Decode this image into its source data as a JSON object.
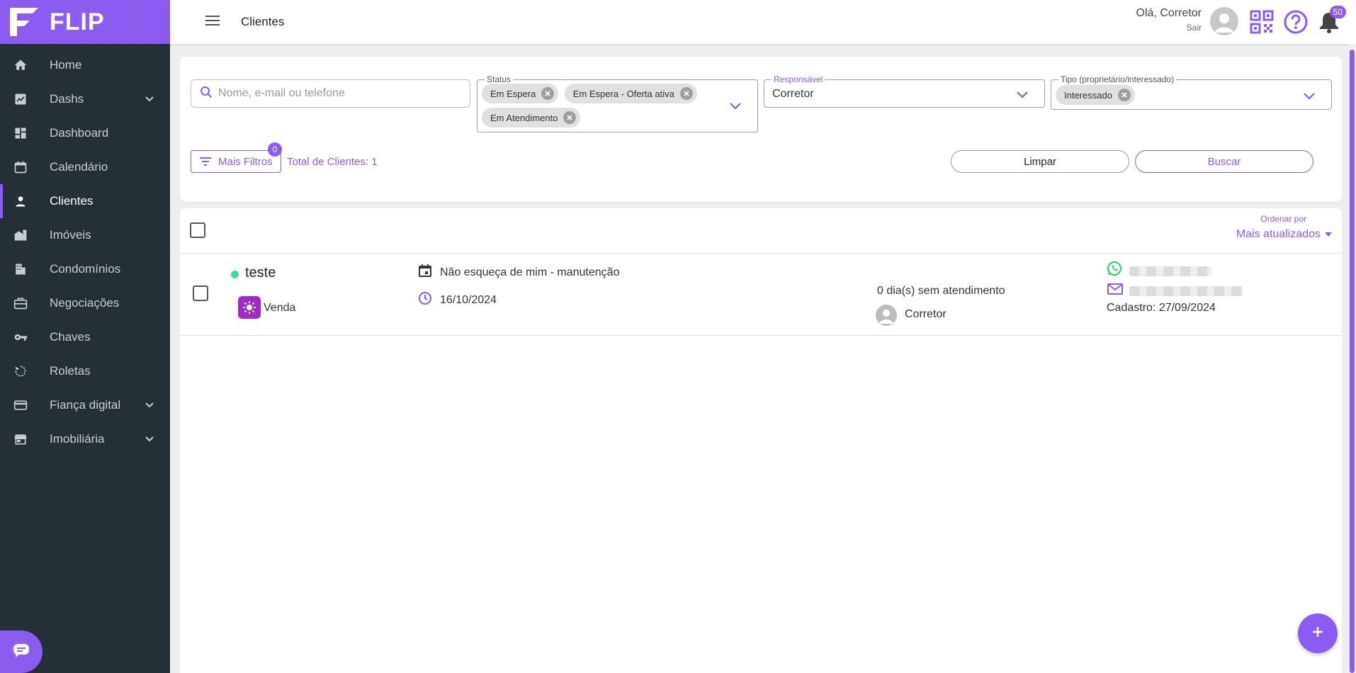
{
  "app": {
    "name": "FLIP"
  },
  "header": {
    "page_title": "Clientes",
    "greeting": "Olá, Corretor",
    "logout": "Sair",
    "notification_count": "50"
  },
  "sidebar": {
    "items": [
      {
        "label": "Home",
        "icon": "home-icon"
      },
      {
        "label": "Dashs",
        "icon": "trend-chart-icon",
        "expandable": true
      },
      {
        "label": "Dashboard",
        "icon": "dashboard-icon"
      },
      {
        "label": "Calendário",
        "icon": "calendar-icon"
      },
      {
        "label": "Clientes",
        "icon": "person-icon",
        "active": true
      },
      {
        "label": "Imóveis",
        "icon": "building-icon"
      },
      {
        "label": "Condomínios",
        "icon": "apartment-icon"
      },
      {
        "label": "Negociações",
        "icon": "briefcase-icon"
      },
      {
        "label": "Chaves",
        "icon": "key-icon"
      },
      {
        "label": "Roletas",
        "icon": "rotate-icon"
      },
      {
        "label": "Fiança digital",
        "icon": "card-icon",
        "expandable": true
      },
      {
        "label": "Imobiliária",
        "icon": "store-icon",
        "expandable": true
      }
    ]
  },
  "filters": {
    "search_placeholder": "Nome, e-mail ou telefone",
    "status": {
      "label": "Status",
      "chips": [
        "Em Espera",
        "Em Espera - Oferta ativa",
        "Em Atendimento"
      ]
    },
    "responsavel": {
      "label": "Responsável",
      "value": "Corretor"
    },
    "tipo": {
      "label": "Tipo (proprietário/interessado)",
      "chips": [
        "Interessado"
      ]
    },
    "more_filters_label": "Mais Filtros",
    "more_filters_count": "0",
    "total_label": "Total de Clientes: 1",
    "clear_label": "Limpar",
    "search_label": "Buscar"
  },
  "list": {
    "order_label": "Ordenar por",
    "order_value": "Mais atualizados",
    "rows": [
      {
        "name": "teste",
        "tag": "Venda",
        "reminder": "Não esqueça de mim - manutenção",
        "date": "16/10/2024",
        "days_without_service": "0 dia(s) sem atendimento",
        "responsible": "Corretor",
        "registration": "Cadastro: 27/09/2024"
      }
    ]
  },
  "colors": {
    "accent": "#8a5cf0",
    "sidebar": "#253036",
    "status_dot": "#3ddc97",
    "whatsapp": "#25d366"
  }
}
